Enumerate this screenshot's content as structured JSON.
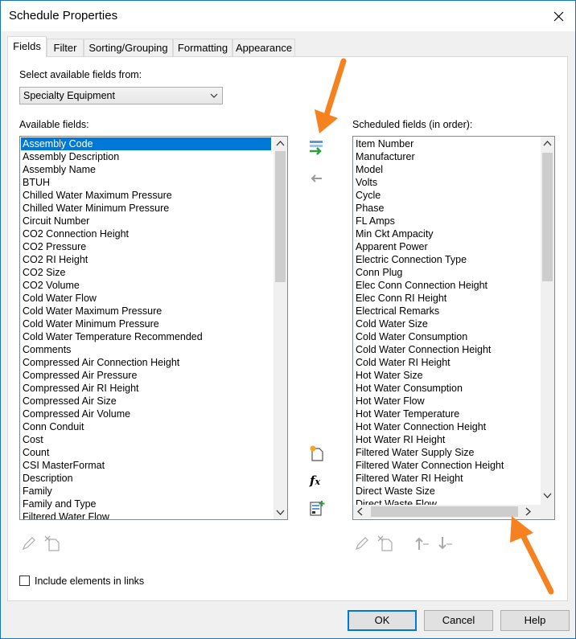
{
  "window": {
    "title": "Schedule Properties"
  },
  "tabs": [
    {
      "label": "Fields"
    },
    {
      "label": "Filter"
    },
    {
      "label": "Sorting/Grouping"
    },
    {
      "label": "Formatting"
    },
    {
      "label": "Appearance"
    }
  ],
  "source": {
    "label": "Select available fields from:",
    "selected": "Specialty Equipment"
  },
  "available": {
    "label": "Available fields:",
    "items": [
      "Assembly Code",
      "Assembly Description",
      "Assembly Name",
      "BTUH",
      "Chilled Water Maximum Pressure",
      "Chilled Water Minimum Pressure",
      "Circuit Number",
      "CO2 Connection Height",
      "CO2 Pressure",
      "CO2 RI Height",
      "CO2 Size",
      "CO2 Volume",
      "Cold Water Flow",
      "Cold Water Maximum Pressure",
      "Cold Water Minimum Pressure",
      "Cold Water Temperature Recommended",
      "Comments",
      "Compressed Air Connection Height",
      "Compressed Air Pressure",
      "Compressed Air RI Height",
      "Compressed Air Size",
      "Compressed Air Volume",
      "Conn Conduit",
      "Cost",
      "Count",
      "CSI MasterFormat",
      "Description",
      "Family",
      "Family and Type",
      "Filtered Water Flow"
    ],
    "selected_index": 0
  },
  "scheduled": {
    "label": "Scheduled fields (in order):",
    "items": [
      "Item Number",
      "Manufacturer",
      "Model",
      "Volts",
      "Cycle",
      "Phase",
      "FL Amps",
      "Min Ckt Ampacity",
      "Apparent Power",
      "Electric Connection Type",
      "Conn Plug",
      "Elec Conn Connection Height",
      "Elec Conn RI Height",
      "Electrical Remarks",
      "Cold Water Size",
      "Cold Water Consumption",
      "Cold Water Connection Height",
      "Cold Water RI Height",
      "Hot Water Size",
      "Hot Water Consumption",
      "Hot Water Flow",
      "Hot Water Temperature",
      "Hot Water Connection Height",
      "Hot Water RI Height",
      "Filtered Water Supply Size",
      "Filtered Water Connection Height",
      "Filtered Water RI Height",
      "Direct Waste Size",
      "Direct Waste Flow"
    ]
  },
  "include_links": {
    "label": "Include elements in links",
    "checked": false
  },
  "buttons": {
    "ok": "OK",
    "cancel": "Cancel",
    "help": "Help"
  },
  "colors": {
    "accent": "#0078d7",
    "annotation_arrow": "#f5821f"
  }
}
